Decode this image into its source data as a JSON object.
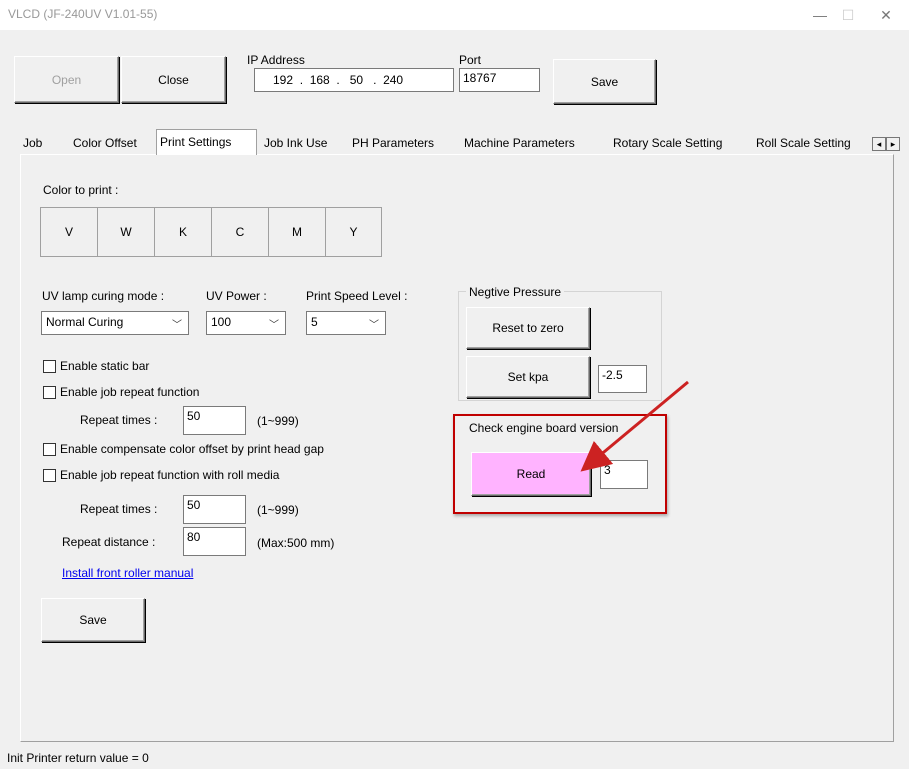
{
  "window": {
    "title": "VLCD (JF-240UV V1.01-55)",
    "minimize_glyph": "—",
    "maximize_glyph": "☐",
    "close_glyph": "✕"
  },
  "toolbar": {
    "open_label": "Open",
    "close_label": "Close",
    "ip_label": "IP Address",
    "ip_value": "192  .  168  .   50   .  240",
    "port_label": "Port",
    "port_value": "18767",
    "save_label": "Save"
  },
  "tabs": [
    {
      "label": "Job"
    },
    {
      "label": "Color Offset"
    },
    {
      "label": "Print Settings"
    },
    {
      "label": "Job Ink Use"
    },
    {
      "label": "PH Parameters"
    },
    {
      "label": "Machine Parameters"
    },
    {
      "label": "Rotary Scale Setting"
    },
    {
      "label": "Roll Scale Setting"
    }
  ],
  "tab_scroll": {
    "left_glyph": "◂",
    "right_glyph": "▸"
  },
  "print_settings": {
    "color_to_print_label": "Color to print :",
    "colors": [
      "V",
      "W",
      "K",
      "C",
      "M",
      "Y"
    ],
    "uv_lamp_label": "UV lamp curing mode :",
    "uv_lamp_value": "Normal Curing",
    "uv_power_label": "UV Power :",
    "uv_power_value": "100",
    "print_speed_label": "Print Speed Level :",
    "print_speed_value": "5",
    "enable_static_bar": "Enable static bar",
    "enable_job_repeat": "Enable job repeat function",
    "repeat_times_label": "Repeat times :",
    "repeat_times_value": "50",
    "repeat_times_range": "(1~999)",
    "enable_compensate": "Enable compensate color offset by print head gap",
    "enable_job_repeat_roll": "Enable job repeat function with roll media",
    "roll_repeat_times_label": "Repeat times :",
    "roll_repeat_times_value": "50",
    "roll_repeat_times_range": "(1~999)",
    "repeat_distance_label": "Repeat distance :",
    "repeat_distance_value": "80",
    "repeat_distance_range": "(Max:500 mm)",
    "install_link": "Install front roller manual",
    "save_label": "Save",
    "negative_pressure_label": "Negtive Pressure",
    "reset_zero_label": "Reset to zero",
    "set_kpa_label": "Set kpa",
    "kpa_value": "-2.5",
    "check_engine_label": "Check engine board version",
    "read_label": "Read",
    "read_value": "3"
  },
  "status": {
    "text": "Init Printer return value = 0"
  },
  "colors": {
    "read_button": "#ffb3ff",
    "highlight_border": "#c00000",
    "arrow": "#cc2222"
  }
}
